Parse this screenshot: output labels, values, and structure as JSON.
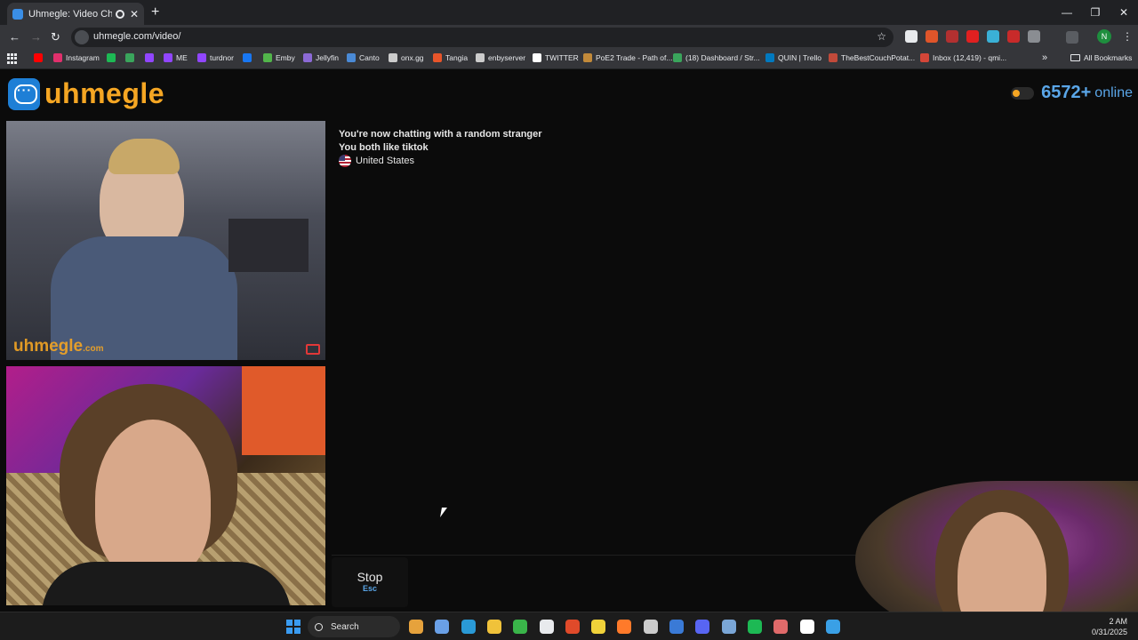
{
  "browser": {
    "tab_title": "Uhmegle: Video Chat | Rando",
    "url": "uhmegle.com/video/",
    "new_tab_label": "+",
    "window_controls": [
      "—",
      "❐",
      "✕"
    ],
    "profile_initial": "N",
    "bookmarks": [
      {
        "label": "",
        "icon": "youtube-icon",
        "color": "#ff0000"
      },
      {
        "label": "Instagram",
        "icon": "instagram-icon",
        "color": "#e1306c"
      },
      {
        "label": "",
        "icon": "spotify-icon",
        "color": "#1db954"
      },
      {
        "label": "",
        "icon": "green-app-icon",
        "color": "#3aa55c"
      },
      {
        "label": "",
        "icon": "twitch-icon",
        "color": "#9146ff"
      },
      {
        "label": "ME",
        "icon": "twitch-icon",
        "color": "#9146ff"
      },
      {
        "label": "turdnor",
        "icon": "twitch-icon",
        "color": "#9146ff"
      },
      {
        "label": "",
        "icon": "facebook-icon",
        "color": "#1877f2"
      },
      {
        "label": "Emby",
        "icon": "emby-icon",
        "color": "#52b54b"
      },
      {
        "label": "Jellyfin",
        "icon": "jellyfin-icon",
        "color": "#8c6ad6"
      },
      {
        "label": "Canto",
        "icon": "canto-icon",
        "color": "#4a8ad6"
      },
      {
        "label": "onx.gg",
        "icon": "onx-icon",
        "color": "#cccccc"
      },
      {
        "label": "Tangia",
        "icon": "tangia-icon",
        "color": "#e8552a"
      },
      {
        "label": "enbyserver",
        "icon": "globe-icon",
        "color": "#cccccc"
      },
      {
        "label": "TWITTER",
        "icon": "x-icon",
        "color": "#ffffff"
      },
      {
        "label": "PoE2 Trade - Path of...",
        "icon": "poe-icon",
        "color": "#c28a3a"
      },
      {
        "label": "(18) Dashboard / Str...",
        "icon": "dashboard-icon",
        "color": "#3aa55c"
      },
      {
        "label": "QUIN | Trello",
        "icon": "trello-icon",
        "color": "#0079bf"
      },
      {
        "label": "TheBestCouchPotat...",
        "icon": "couch-icon",
        "color": "#c24a3a"
      },
      {
        "label": "Inbox (12,419) - qmi...",
        "icon": "gmail-icon",
        "color": "#d44638"
      }
    ],
    "all_bookmarks_label": "All Bookmarks"
  },
  "site": {
    "logo_text": "uhmegle",
    "online_count": "6572+",
    "online_label": "online",
    "watermark": "uhmegle",
    "watermark_suffix": ".com"
  },
  "chat": {
    "lines": [
      "You're now chatting with a random stranger",
      "You both like tiktok"
    ],
    "country": "United States"
  },
  "controls": {
    "stop_label": "Stop",
    "stop_key": "Esc"
  },
  "taskbar": {
    "search_label": "Search",
    "time": "2 AM",
    "date": "0/31/2025",
    "apps": [
      {
        "icon": "weather-icon",
        "color": "#e6a23c"
      },
      {
        "icon": "copilot-icon",
        "color": "#6aa0e6"
      },
      {
        "icon": "edge-icon",
        "color": "#2a9ad6"
      },
      {
        "icon": "folder-icon",
        "color": "#f0c23a"
      },
      {
        "icon": "play-icon",
        "color": "#3ab54a"
      },
      {
        "icon": "chrome-icon",
        "color": "#e8eaed"
      },
      {
        "icon": "app-red-icon",
        "color": "#e04a2a"
      },
      {
        "icon": "sticky-notes-icon",
        "color": "#f0d23a"
      },
      {
        "icon": "firefox-icon",
        "color": "#ff7a2a"
      },
      {
        "icon": "obs-icon",
        "color": "#cccccc"
      },
      {
        "icon": "thunderbird-icon",
        "color": "#3a7ad6"
      },
      {
        "icon": "discord-icon",
        "color": "#5865f2"
      },
      {
        "icon": "steam-icon",
        "color": "#7aa6d6"
      },
      {
        "icon": "spotify-icon",
        "color": "#1db954"
      },
      {
        "icon": "app-icon",
        "color": "#e06a6a"
      },
      {
        "icon": "capcut-icon",
        "color": "#ffffff"
      },
      {
        "icon": "notepad-icon",
        "color": "#3aa0e6"
      }
    ]
  }
}
